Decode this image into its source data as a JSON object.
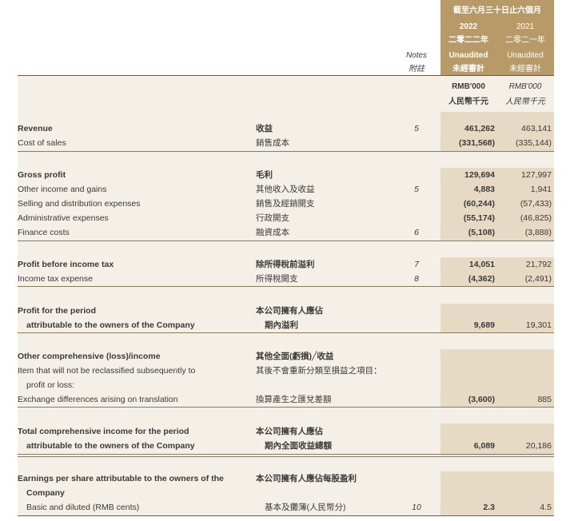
{
  "header": {
    "period_title": "截至六月三十日止六個月",
    "year_current": "2022",
    "year_prior": "2021",
    "year_current_cn": "二零二二年",
    "year_prior_cn": "二零二一年",
    "notes_en": "Notes",
    "notes_cn": "附註",
    "unaudited_current": "Unaudited",
    "unaudited_current_cn": "未經審計",
    "unaudited_prior": "Unaudited",
    "unaudited_prior_cn": "未經審計",
    "currency_current": "RMB'000",
    "currency_current_cn": "人民幣千元",
    "currency_prior": "RMB'000",
    "currency_prior_cn": "人民幣千元"
  },
  "rows": {
    "revenue": {
      "en": "Revenue",
      "cn": "收益",
      "note": "5",
      "v2022": "461,262",
      "v2021": "463,141"
    },
    "cost_of_sales": {
      "en": "Cost of sales",
      "cn": "銷售成本",
      "note": "",
      "v2022": "(331,568)",
      "v2021": "(335,144)"
    },
    "gross_profit": {
      "en": "Gross profit",
      "cn": "毛利",
      "note": "",
      "v2022": "129,694",
      "v2021": "127,997"
    },
    "other_income": {
      "en": "Other income and gains",
      "cn": "其他收入及收益",
      "note": "5",
      "v2022": "4,883",
      "v2021": "1,941"
    },
    "selling": {
      "en": "Selling and distribution expenses",
      "cn": "銷售及經銷開支",
      "note": "",
      "v2022": "(60,244)",
      "v2021": "(57,433)"
    },
    "admin": {
      "en": "Administrative expenses",
      "cn": "行政開支",
      "note": "",
      "v2022": "(55,174)",
      "v2021": "(46,825)"
    },
    "finance": {
      "en": "Finance costs",
      "cn": "融資成本",
      "note": "6",
      "v2022": "(5,108)",
      "v2021": "(3,888)"
    },
    "pbt": {
      "en": "Profit before income tax",
      "cn": "除所得稅前溢利",
      "note": "7",
      "v2022": "14,051",
      "v2021": "21,792"
    },
    "tax": {
      "en": "Income tax expense",
      "cn": "所得稅開支",
      "note": "8",
      "v2022": "(4,362)",
      "v2021": "(2,491)"
    },
    "profit_period": {
      "en1": "Profit for the period",
      "en2": "attributable to the owners of the Company",
      "cn1": "本公司擁有人應佔",
      "cn2": "期內溢利",
      "v2022": "9,689",
      "v2021": "19,301"
    },
    "oci": {
      "en1": "Other comprehensive (loss)/income",
      "en2": "Item that will not be reclassified subsequently to",
      "en3": "profit or loss:",
      "cn1": "其他全面(虧損)╱收益",
      "cn2": "其後不會重新分類至損益之項目："
    },
    "exchange": {
      "en": "Exchange differences arising on translation",
      "cn": "換算產生之匯兌差額",
      "v2022": "(3,600)",
      "v2021": "885"
    },
    "tci": {
      "en1": "Total comprehensive income for the period",
      "en2": "attributable to the owners of the Company",
      "cn1": "本公司擁有人應佔",
      "cn2": "期內全面收益總額",
      "v2022": "6,089",
      "v2021": "20,186"
    },
    "eps": {
      "en1": "Earnings per share attributable to the owners of the",
      "en2": "Company",
      "en3": "Basic and diluted (RMB cents)",
      "cn1": "本公司擁有人應佔每股盈利",
      "cn2": "基本及攤薄(人民幣分)",
      "note": "10",
      "v2022": "2.3",
      "v2021": "4.5"
    }
  }
}
